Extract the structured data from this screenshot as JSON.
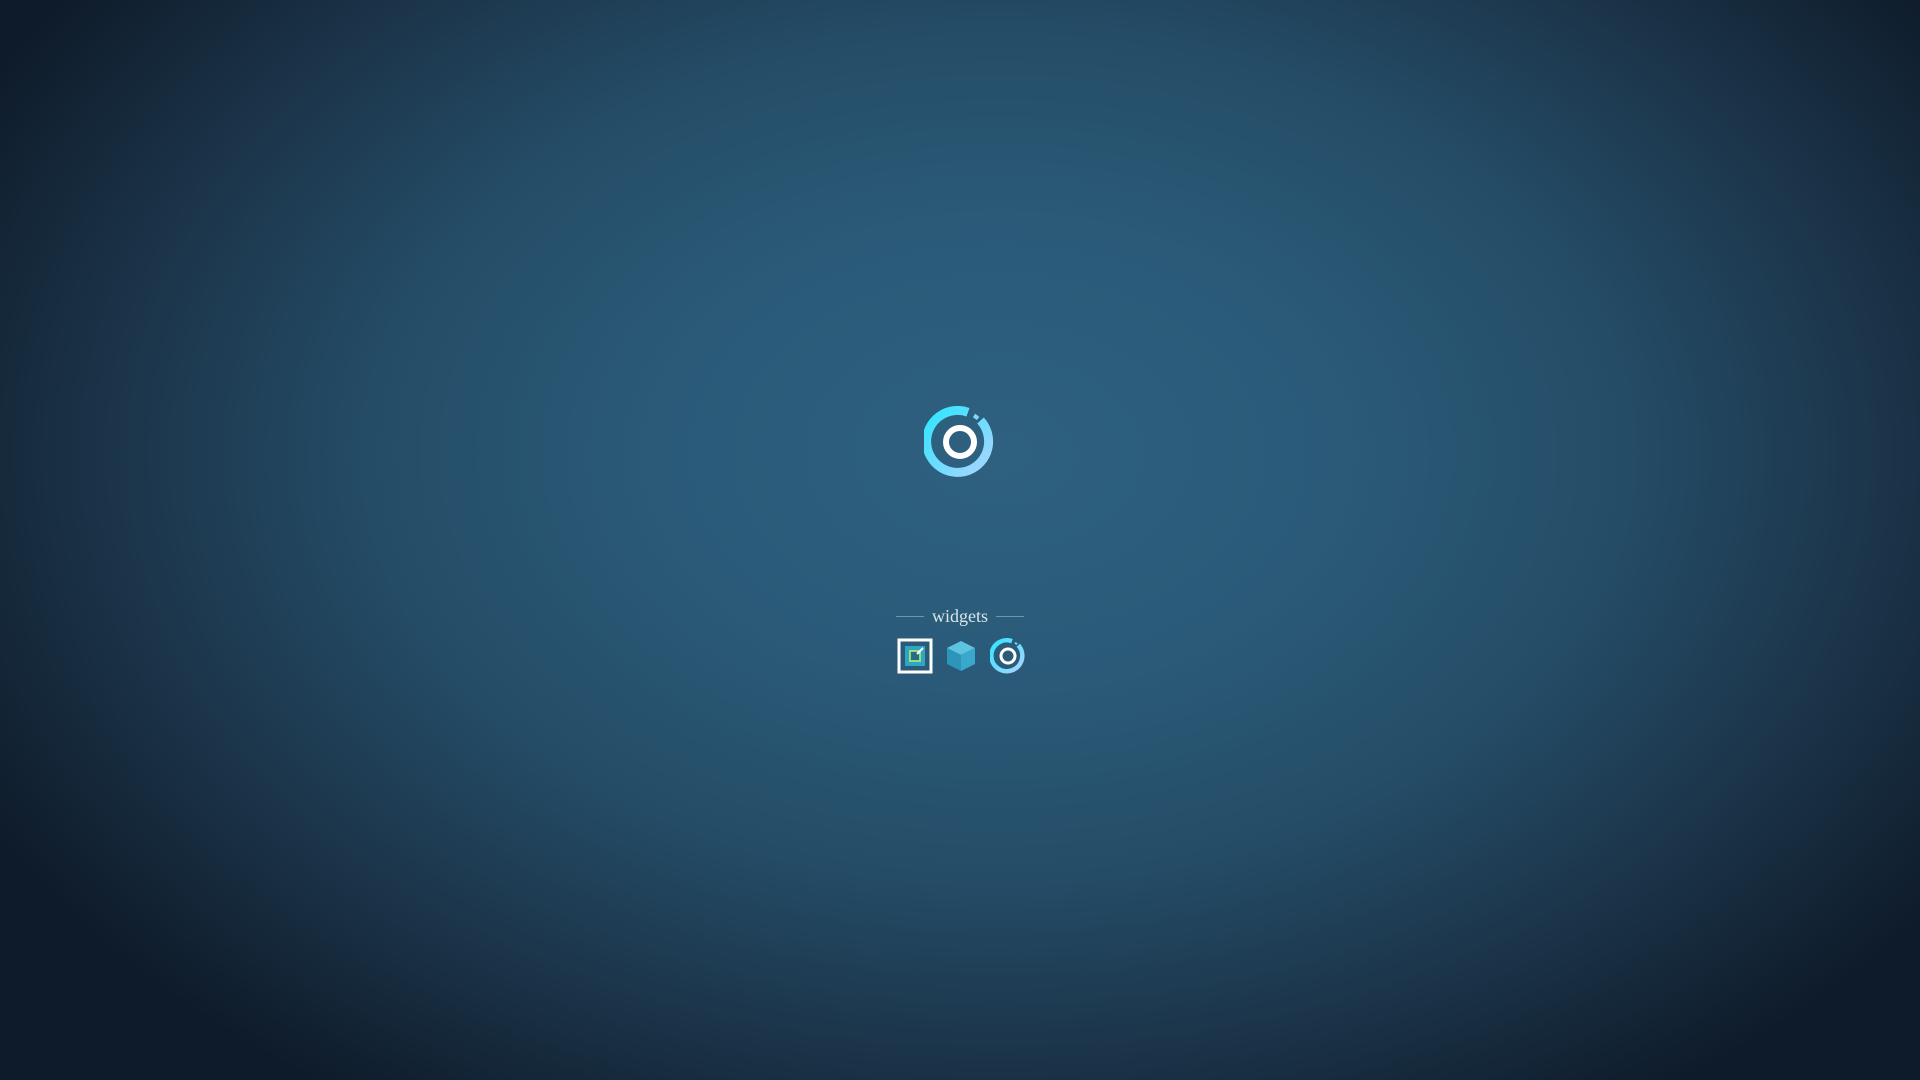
{
  "desktop": {
    "center_icon": "ring-logo-icon"
  },
  "widgets": {
    "title": "widgets",
    "items": [
      {
        "icon": "framed-square-icon"
      },
      {
        "icon": "cube-icon"
      },
      {
        "icon": "ring-logo-icon"
      }
    ]
  },
  "colors": {
    "background_center": "#2e6080",
    "background_edge": "#0e1b2a",
    "accent_cyan": "#2ee6ff",
    "accent_light_blue": "#8fd8ff",
    "cube_blue": "#3aa6c8",
    "text": "#d8e6ee"
  }
}
